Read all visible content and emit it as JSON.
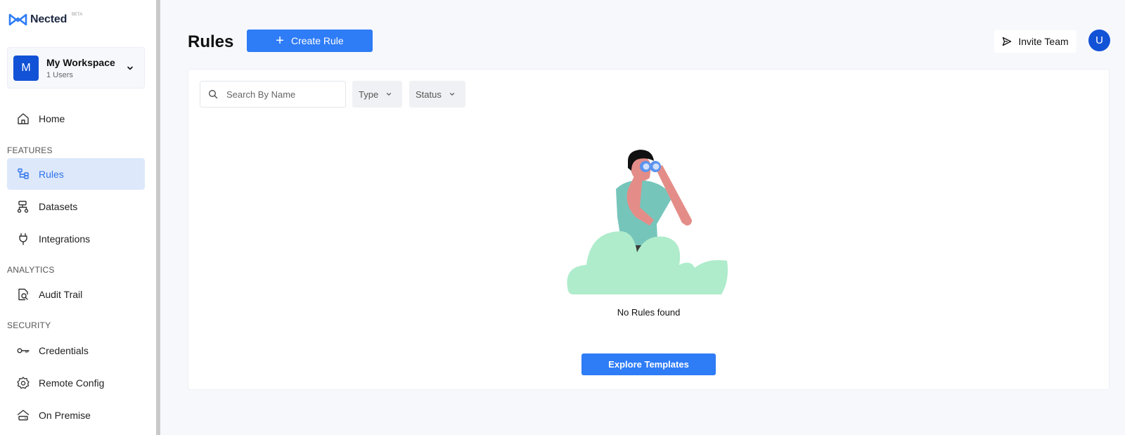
{
  "brand": {
    "name": "Nected",
    "badge": "BETA"
  },
  "workspace": {
    "initial": "M",
    "name": "My Workspace",
    "users": "1 Users"
  },
  "nav": {
    "home": "Home",
    "sections": {
      "features": "FEATURES",
      "analytics": "ANALYTICS",
      "security": "SECURITY"
    },
    "items": {
      "rules": "Rules",
      "datasets": "Datasets",
      "integrations": "Integrations",
      "audit_trail": "Audit Trail",
      "credentials": "Credentials",
      "remote_config": "Remote Config",
      "on_premise": "On Premise"
    }
  },
  "header": {
    "title": "Rules",
    "create_label": "Create Rule",
    "invite_label": "Invite Team",
    "user_initial": "U"
  },
  "filters": {
    "search_placeholder": "Search By Name",
    "type_label": "Type",
    "status_label": "Status"
  },
  "empty_state": {
    "message": "No Rules found",
    "explore_label": "Explore Templates"
  },
  "colors": {
    "primary": "#2e7cf6",
    "avatar": "#1252d6",
    "active_nav_bg": "#dde8fb",
    "page_bg": "#f7f8fc"
  }
}
